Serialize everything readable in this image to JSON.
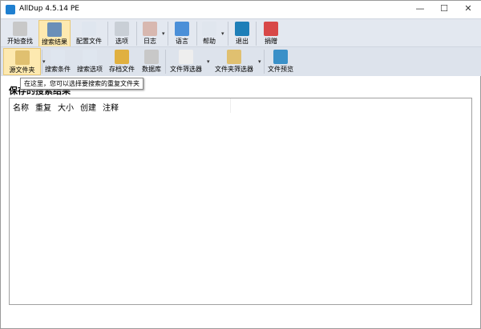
{
  "window": {
    "title": "AllDup 4.5.14 PE",
    "minimize": "—",
    "maximize": "☐",
    "close": "✕"
  },
  "toolbar1": [
    {
      "label": "开始查找",
      "icon": "search-icon",
      "color": "#c8c8c8"
    },
    {
      "label": "搜索结果",
      "icon": "results-icon",
      "color": "#6a8fb8",
      "active": true
    },
    {
      "label": "配置文件",
      "icon": "profile-icon",
      "color": "#dfe6ef"
    },
    {
      "label": "选项",
      "icon": "options-icon",
      "color": "#c9cfd6"
    },
    {
      "label": "日志",
      "icon": "log-icon",
      "color": "#d8b8b0"
    },
    {
      "label": "语言",
      "icon": "language-icon",
      "color": "#4a8fd8"
    },
    {
      "label": "帮助",
      "icon": "help-icon",
      "color": "#e0e6ee"
    },
    {
      "label": "退出",
      "icon": "exit-icon",
      "color": "#1e7fb8"
    },
    {
      "label": "捐赠",
      "icon": "donate-icon",
      "color": "#d84848"
    }
  ],
  "toolbar2": [
    {
      "label": "源文件夹",
      "icon": "source-folder-icon",
      "color": "#e0c070",
      "active": true
    },
    {
      "label": "搜索条件",
      "icon": "search-criteria-icon",
      "color": "#dfe6ef"
    },
    {
      "label": "搜索选项",
      "icon": "search-options-icon",
      "color": "#dfe6ef"
    },
    {
      "label": "存档文件",
      "icon": "archive-icon",
      "color": "#e0b040"
    },
    {
      "label": "数据库",
      "icon": "database-icon",
      "color": "#c8c8c8"
    },
    {
      "label": "文件筛选器",
      "icon": "file-filter-icon",
      "color": "#eeeeee"
    },
    {
      "label": "文件夹筛选器",
      "icon": "folder-filter-icon",
      "color": "#e0c070"
    },
    {
      "label": "文件预览",
      "icon": "file-preview-icon",
      "color": "#3a90c8"
    }
  ],
  "tooltip": "在这里，您可以选择要搜索的重复文件夹",
  "heading": "保存的搜索结果",
  "columns": [
    "名称",
    "重复",
    "大小",
    "创建",
    "注释"
  ]
}
